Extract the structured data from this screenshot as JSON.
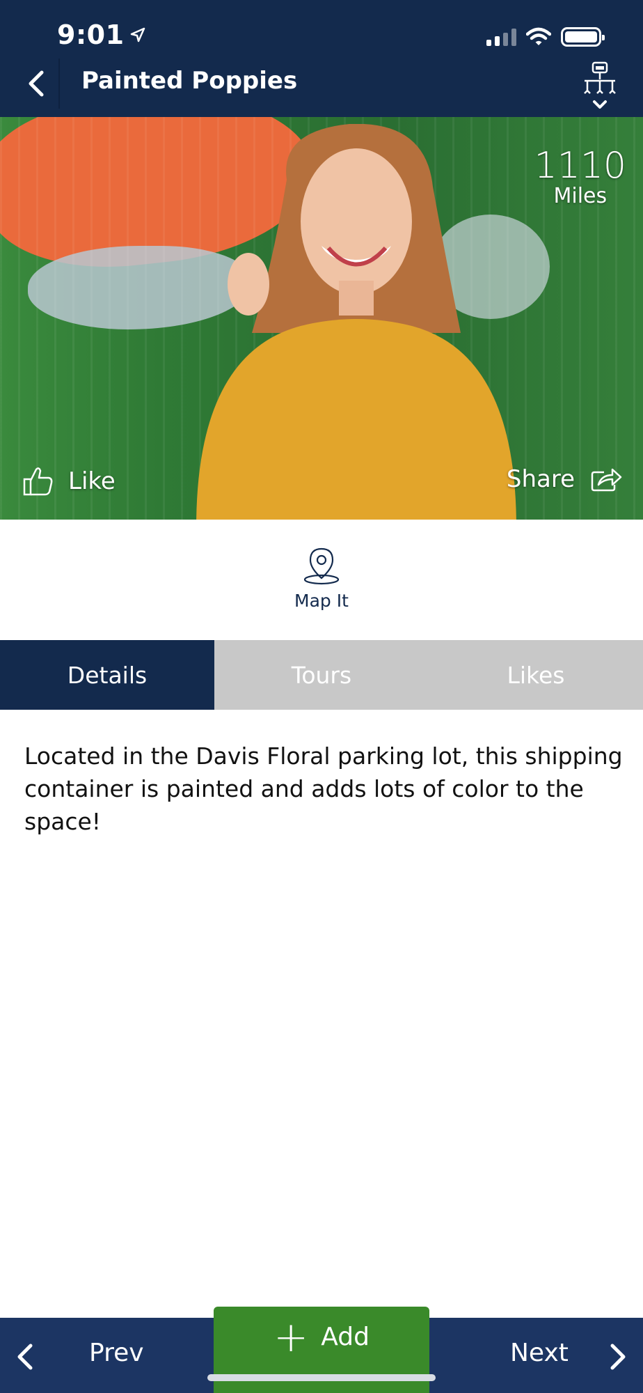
{
  "status_bar": {
    "time": "9:01",
    "signal_bars_active": 2,
    "signal_bars_total": 4,
    "battery_level": 1.0
  },
  "header": {
    "title": "Painted Poppies",
    "back_icon": "chevron-left-icon",
    "tour_icon": "tour-toggle-icon"
  },
  "hero": {
    "distance_value": "1110",
    "distance_unit": "Miles",
    "like_label": "Like",
    "share_label": "Share"
  },
  "map_it": {
    "label": "Map It",
    "icon": "location-pin-icon"
  },
  "tabs": [
    {
      "label": "Details",
      "active": true
    },
    {
      "label": "Tours",
      "active": false
    },
    {
      "label": "Likes",
      "active": false
    }
  ],
  "details": {
    "description": "Located in the Davis Floral parking lot, this shipping container is painted and adds lots of color to the space!"
  },
  "bottom_nav": {
    "prev_label": "Prev",
    "add_label": "Add",
    "next_label": "Next"
  },
  "colors": {
    "header_bg": "#132a4d",
    "bottom_bar_bg": "#1c3563",
    "add_button_bg": "#3a8a2a",
    "tab_inactive_bg": "#c8c8c8"
  }
}
